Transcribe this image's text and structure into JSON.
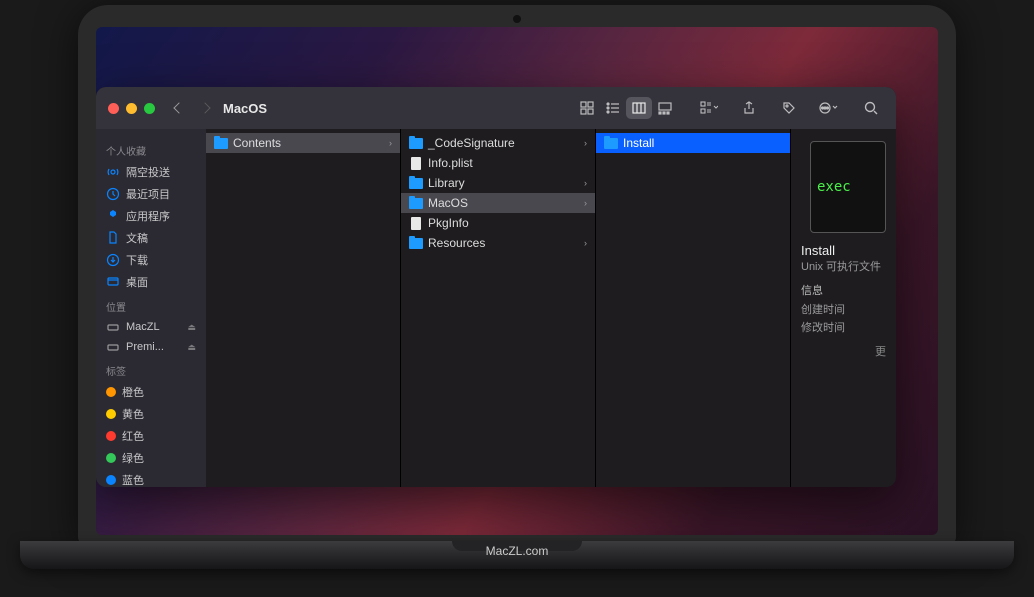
{
  "window": {
    "title": "MacOS"
  },
  "sidebar": {
    "favorites_heading": "个人收藏",
    "favorites": [
      {
        "label": "隔空投送",
        "icon": "airdrop"
      },
      {
        "label": "最近项目",
        "icon": "recents"
      },
      {
        "label": "应用程序",
        "icon": "apps"
      },
      {
        "label": "文稿",
        "icon": "document"
      },
      {
        "label": "下载",
        "icon": "downloads"
      },
      {
        "label": "桌面",
        "icon": "desktop"
      }
    ],
    "locations_heading": "位置",
    "locations": [
      {
        "label": "MacZL",
        "icon": "disk"
      },
      {
        "label": "Premi...",
        "icon": "disk"
      }
    ],
    "tags_heading": "标签",
    "tags": [
      {
        "label": "橙色",
        "color": "#ff9500"
      },
      {
        "label": "黄色",
        "color": "#ffcc00"
      },
      {
        "label": "红色",
        "color": "#ff3b30"
      },
      {
        "label": "绿色",
        "color": "#34c759"
      },
      {
        "label": "蓝色",
        "color": "#0a84ff"
      }
    ]
  },
  "columns": [
    {
      "items": [
        {
          "name": "Contents",
          "type": "folder",
          "selected": "grey",
          "has_children": true
        }
      ]
    },
    {
      "items": [
        {
          "name": "_CodeSignature",
          "type": "folder",
          "selected": null,
          "has_children": true
        },
        {
          "name": "Info.plist",
          "type": "file",
          "selected": null,
          "has_children": false
        },
        {
          "name": "Library",
          "type": "folder",
          "selected": null,
          "has_children": true
        },
        {
          "name": "MacOS",
          "type": "folder",
          "selected": "grey",
          "has_children": true
        },
        {
          "name": "PkgInfo",
          "type": "file",
          "selected": null,
          "has_children": false
        },
        {
          "name": "Resources",
          "type": "folder",
          "selected": null,
          "has_children": true
        }
      ]
    },
    {
      "items": [
        {
          "name": "Install",
          "type": "folder",
          "selected": "blue",
          "has_children": false
        }
      ]
    }
  ],
  "preview": {
    "thumb_text": "exec",
    "name": "Install",
    "kind": "Unix 可执行文件",
    "info_heading": "信息",
    "created_label": "创建时间",
    "modified_label": "修改时间",
    "more": "更"
  },
  "base_label": "MacZL.com"
}
